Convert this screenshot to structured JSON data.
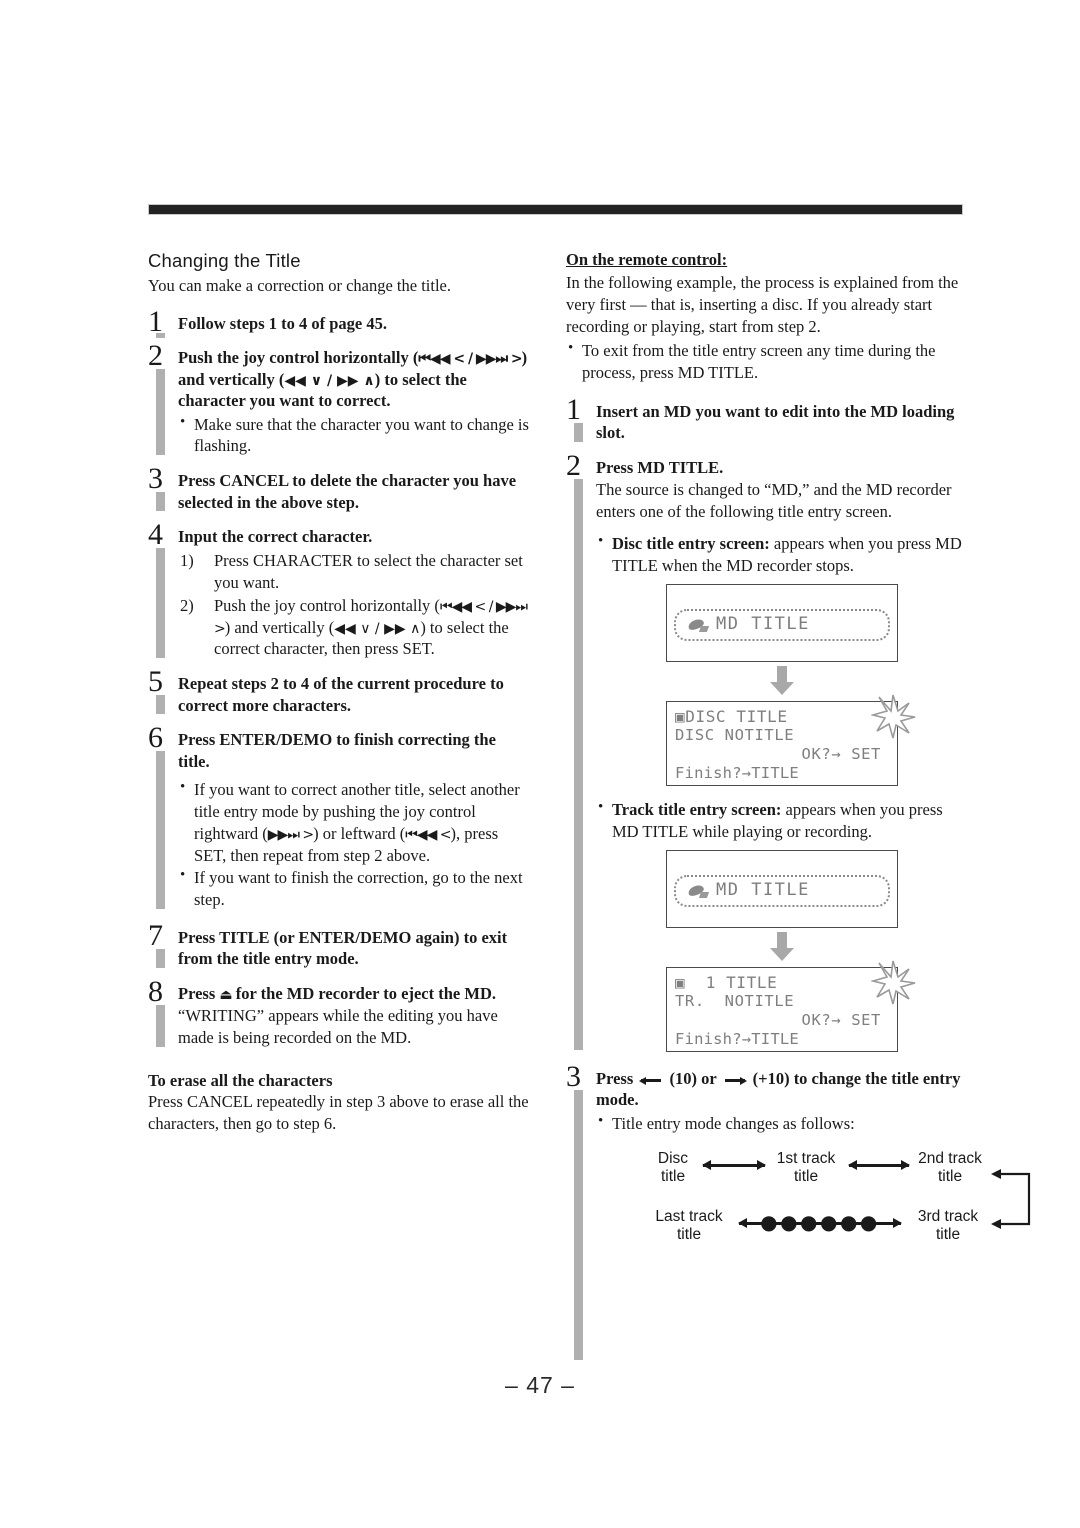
{
  "page": {
    "number_label": "– 47 –"
  },
  "left": {
    "section_heading": "Changing the Title",
    "section_lead": "You can make a correction or change the title.",
    "steps": [
      {
        "num": "1",
        "title": "Follow steps 1 to 4 of page 45."
      },
      {
        "num": "2",
        "title_pre": "Push the joy control horizontally (",
        "sym_h": "⏮◀◀ < / ▶▶⏭ >",
        "title_mid": ") and vertically (",
        "sym_v": "◀◀ ∨ / ▶▶ ∧",
        "title_post": ") to select the character you want to correct.",
        "bullets": [
          "Make sure that the character you want to change is flashing."
        ]
      },
      {
        "num": "3",
        "title": "Press CANCEL to delete the character you have selected in the above step."
      },
      {
        "num": "4",
        "title": "Input the correct character.",
        "substeps": [
          {
            "label": "1)",
            "text": "Press CHARACTER to select the character set you want."
          },
          {
            "label": "2)",
            "pre": "Push the joy control horizontally (",
            "sym_h": "⏮◀◀ < / ▶▶⏭ >",
            "mid": ") and vertically (",
            "sym_v": "◀◀ ∨ / ▶▶ ∧",
            "post": ") to select the correct character, then press SET."
          }
        ]
      },
      {
        "num": "5",
        "title": "Repeat steps 2 to 4 of the current procedure to correct more characters."
      },
      {
        "num": "6",
        "title": "Press ENTER/DEMO to finish correcting the title.",
        "bullet1_pre": "If you want to correct another title, select another title entry mode by pushing the joy control rightward (",
        "bullet1_sym_r": "▶▶⏭ >",
        "bullet1_mid": ") or leftward (",
        "bullet1_sym_l": "⏮◀◀ <",
        "bullet1_post": "), press SET, then repeat from step 2 above.",
        "bullet2": "If you want to finish the correction, go to the next step."
      },
      {
        "num": "7",
        "title": "Press TITLE (or ENTER/DEMO again) to exit from the title entry mode."
      },
      {
        "num": "8",
        "title_pre": "Press ",
        "title_sym": "⏏",
        "title_post": " for the MD recorder to eject the MD.",
        "body": "“WRITING” appears while the editing you have made is being recorded on the MD."
      }
    ],
    "erase_heading": "To erase all the characters",
    "erase_body": "Press CANCEL repeatedly in step 3 above to erase all the characters, then go to step 6."
  },
  "right": {
    "heading": "On the remote control:",
    "intro": "In the following example, the process is explained from the very first — that is, inserting a disc. If you already start recording or playing, start from step 2.",
    "intro_bullet": "To exit from the title entry screen any time during the process, press MD TITLE.",
    "steps": [
      {
        "num": "1",
        "title": "Insert an MD you want to edit into the MD loading slot."
      },
      {
        "num": "2",
        "title": "Press MD TITLE.",
        "body": "The source is changed to “MD,” and the MD recorder enters one of the following title entry screen.",
        "bullet_disc_bold": "Disc title entry screen:",
        "bullet_disc_rest": " appears when you press MD TITLE when the MD recorder stops.",
        "bullet_track_bold": "Track title entry screen:",
        "bullet_track_rest": " appears when you press MD TITLE while playing or recording."
      },
      {
        "num": "3",
        "title_pre": "Press ",
        "title_mid1": " (10) or ",
        "title_mid2": " (+10) to change the title entry mode.",
        "bullet": "Title entry mode changes as follows:"
      }
    ],
    "lcd": {
      "disc_screen_1": {
        "title": "MD TITLE"
      },
      "disc_screen_2": {
        "row1": "▣DISC TITLE",
        "row2": "DISC NOTITLE",
        "row3": "OK?→ SET",
        "row4": "Finish?→TITLE"
      },
      "track_screen_1": {
        "title": "MD TITLE"
      },
      "track_screen_2": {
        "row1": "▣  1 TITLE",
        "row2": "TR.  NOTITLE",
        "row3": "OK?→ SET",
        "row4": "Finish?→TITLE"
      }
    },
    "flow": {
      "n1_l1": "Disc",
      "n1_l2": "title",
      "n2_l1": "1st track",
      "n2_l2": "title",
      "n3_l1": "2nd track",
      "n3_l2": "title",
      "n4_l1": "3rd track",
      "n4_l2": "title",
      "n5_l1": "Last track",
      "n5_l2": "title",
      "dots": "●●●●●●"
    }
  }
}
